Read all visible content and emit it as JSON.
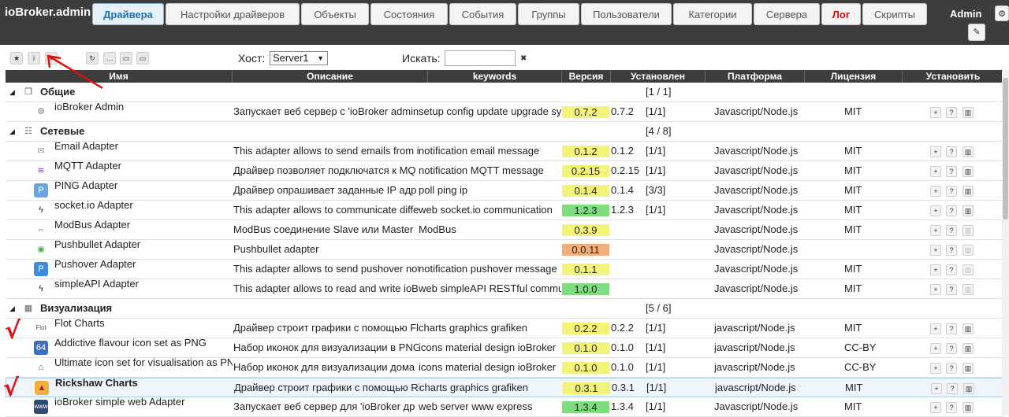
{
  "brand": "ioBroker.admin",
  "user": "Admin",
  "tabs": [
    "Драйвера",
    "Настройки драйверов",
    "Объекты",
    "Состояния",
    "События",
    "Группы",
    "Пользователи",
    "Категории",
    "Сервера",
    "Лог",
    "Скрипты"
  ],
  "toolbar": {
    "host_label": "Хост:",
    "host_value": "Server1",
    "search_label": "Искать:",
    "search_value": ""
  },
  "columns": [
    "Имя",
    "Описание",
    "keywords",
    "Версия",
    "Установлен",
    "Платформа",
    "Лицензия",
    "Установить"
  ],
  "groups": {
    "common": {
      "name": "Общие",
      "count": "[1 / 1]"
    },
    "network": {
      "name": "Сетевые",
      "count": "[4 / 8]"
    },
    "visual": {
      "name": "Визуализация",
      "count": "[5 / 6]"
    }
  },
  "rows": [
    {
      "name": "ioBroker Admin",
      "desc": "Запускает веб сервер с 'ioBroker admin",
      "keywords": "setup config update upgrade sy",
      "version": "0.7.2",
      "installed": "0.7.2",
      "inst_count": "[1/1]",
      "platform": "Javascript/Node.js",
      "license": "MIT"
    },
    {
      "name": "Email Adapter",
      "desc": "This adapter allows to send emails from i",
      "keywords": "notification email message",
      "version": "0.1.2",
      "installed": "0.1.2",
      "inst_count": "[1/1]",
      "platform": "Javascript/Node.js",
      "license": "MIT"
    },
    {
      "name": "MQTT Adapter",
      "desc": "Драйвер позволяет подключатся к MQ",
      "keywords": "notification MQTT message",
      "version": "0.2.15",
      "installed": "0.2.15",
      "inst_count": "[1/1]",
      "platform": "Javascript/Node.js",
      "license": "MIT"
    },
    {
      "name": "PING Adapter",
      "desc": "Драйвер опрашивает заданные IP адр",
      "keywords": "poll ping ip",
      "version": "0.1.4",
      "installed": "0.1.4",
      "inst_count": "[3/3]",
      "platform": "Javascript/Node.js",
      "license": "MIT"
    },
    {
      "name": "socket.io Adapter",
      "desc": "This adapter allows to communicate diffe",
      "keywords": "web socket.io communication",
      "version": "1.2.3",
      "installed": "1.2.3",
      "inst_count": "[1/1]",
      "platform": "Javascript/Node.js",
      "license": "MIT"
    },
    {
      "name": "ModBus Adapter",
      "desc": "ModBus соединение Slave или Master",
      "keywords": "ModBus",
      "version": "0.3.9",
      "installed": "",
      "inst_count": "",
      "platform": "Javascript/Node.js",
      "license": "MIT"
    },
    {
      "name": "Pushbullet Adapter",
      "desc": "Pushbullet adapter",
      "keywords": "",
      "version": "0.0.11",
      "installed": "",
      "inst_count": "",
      "platform": "Javascript/Node.js",
      "license": ""
    },
    {
      "name": "Pushover Adapter",
      "desc": "This adapter allows to send pushover not",
      "keywords": "notification pushover message",
      "version": "0.1.1",
      "installed": "",
      "inst_count": "",
      "platform": "Javascript/Node.js",
      "license": "MIT"
    },
    {
      "name": "simpleAPI Adapter",
      "desc": "This adapter allows to read and write ioB",
      "keywords": "web simpleAPI RESTful commu",
      "version": "1.0.0",
      "installed": "",
      "inst_count": "",
      "platform": "Javascript/Node.js",
      "license": "MIT"
    },
    {
      "name": "Flot Charts",
      "desc": "Драйвер строит графики с помощью Fl",
      "keywords": "charts graphics grafiken",
      "version": "0.2.2",
      "installed": "0.2.2",
      "inst_count": "[1/1]",
      "platform": "javascript/Node.js",
      "license": "MIT"
    },
    {
      "name": "Addictive flavour icon set as PNG",
      "desc": "Набор иконок для визуализации в PNG",
      "keywords": "icons material design ioBroker",
      "version": "0.1.0",
      "installed": "0.1.0",
      "inst_count": "[1/1]",
      "platform": "javascript/Node.js",
      "license": "CC-BY"
    },
    {
      "name": "Ultimate icon set for visualisation as PN",
      "desc": "Набор иконок для визуализации дома",
      "keywords": "icons material design ioBroker",
      "version": "0.1.0",
      "installed": "0.1.0",
      "inst_count": "[1/1]",
      "platform": "javascript/Node.js",
      "license": "CC-BY"
    },
    {
      "name": "Rickshaw Charts",
      "desc": "Драйвер строит графики с помощью Ri",
      "keywords": "charts graphics grafiken",
      "version": "0.3.1",
      "installed": "0.3.1",
      "inst_count": "[1/1]",
      "platform": "javascript/Node.js",
      "license": "MIT"
    },
    {
      "name": "ioBroker simple web Adapter",
      "desc": "Запускает веб сервер для 'ioBroker др",
      "keywords": "web server www express",
      "version": "1.3.4",
      "installed": "1.3.4",
      "inst_count": "[1/1]",
      "platform": "Javascript/Node.js",
      "license": "MIT"
    }
  ],
  "colors": {
    "bar": "#3d3d3d",
    "active_tab": "#1f6fb5",
    "version_yellow": "#f3f37a",
    "version_green": "#7fdc7f",
    "version_orange": "#f2b078",
    "annotation": "#e01010"
  }
}
